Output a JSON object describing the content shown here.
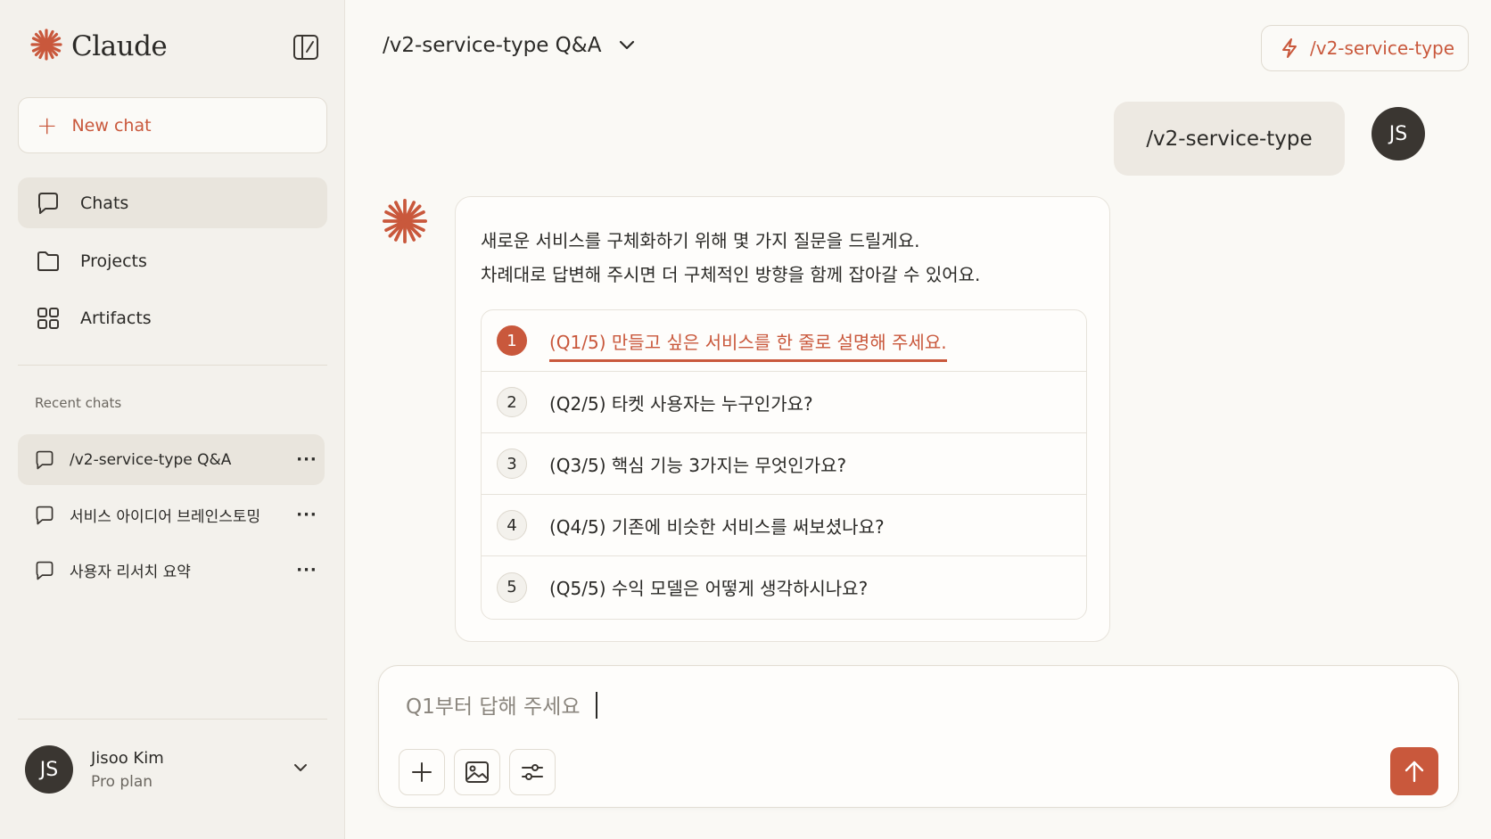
{
  "colors": {
    "accent": "#c9583c",
    "sidebar_bg": "#f3f1ec",
    "main_bg": "#faf9f5"
  },
  "app": {
    "name": "Claude",
    "logo_icon": "claude-asterisk-icon"
  },
  "sidebar": {
    "new_chat_label": "New chat",
    "nav": [
      {
        "label": "Chats",
        "icon": "chat-bubble-icon",
        "active": true
      },
      {
        "label": "Projects",
        "icon": "folder-icon",
        "active": false
      },
      {
        "label": "Artifacts",
        "icon": "grid-icon",
        "active": false
      }
    ],
    "recent_label": "Recent chats",
    "recent": [
      {
        "label": "/v2-service-type Q&A",
        "active": true
      },
      {
        "label": "서비스 아이디어 브레인스토밍",
        "active": false
      },
      {
        "label": "사용자 리서치 요약",
        "active": false
      }
    ],
    "more_glyph": "···",
    "user": {
      "initials": "JS",
      "name": "Jisoo Kim",
      "plan": "Pro plan"
    }
  },
  "header": {
    "chat_title": "/v2-service-type Q&A",
    "command_chip": "/v2-service-type"
  },
  "conversation": {
    "user_message": "/v2-service-type",
    "user_initials": "JS",
    "assistant_intro": [
      "새로운 서비스를 구체화하기 위해 몇 가지 질문을 드릴게요.",
      "차례대로 답변해 주시면 더 구체적인 방향을 함께 잡아갈 수 있어요."
    ],
    "questions": [
      {
        "num": "1",
        "text": "(Q1/5) 만들고 싶은 서비스를 한 줄로 설명해 주세요.",
        "active": true
      },
      {
        "num": "2",
        "text": "(Q2/5) 타켓 사용자는 누구인가요?",
        "active": false
      },
      {
        "num": "3",
        "text": "(Q3/5) 핵심 기능 3가지는 무엇인가요?",
        "active": false
      },
      {
        "num": "4",
        "text": "(Q4/5) 기존에 비슷한 서비스를 써보셨나요?",
        "active": false
      },
      {
        "num": "5",
        "text": "(Q5/5) 수익 모델은 어떻게 생각하시나요?",
        "active": false
      }
    ]
  },
  "composer": {
    "placeholder": "Q1부터 답해 주세요",
    "tools": [
      "plus-icon",
      "image-icon",
      "sliders-icon"
    ],
    "send_icon": "arrow-up-icon"
  }
}
